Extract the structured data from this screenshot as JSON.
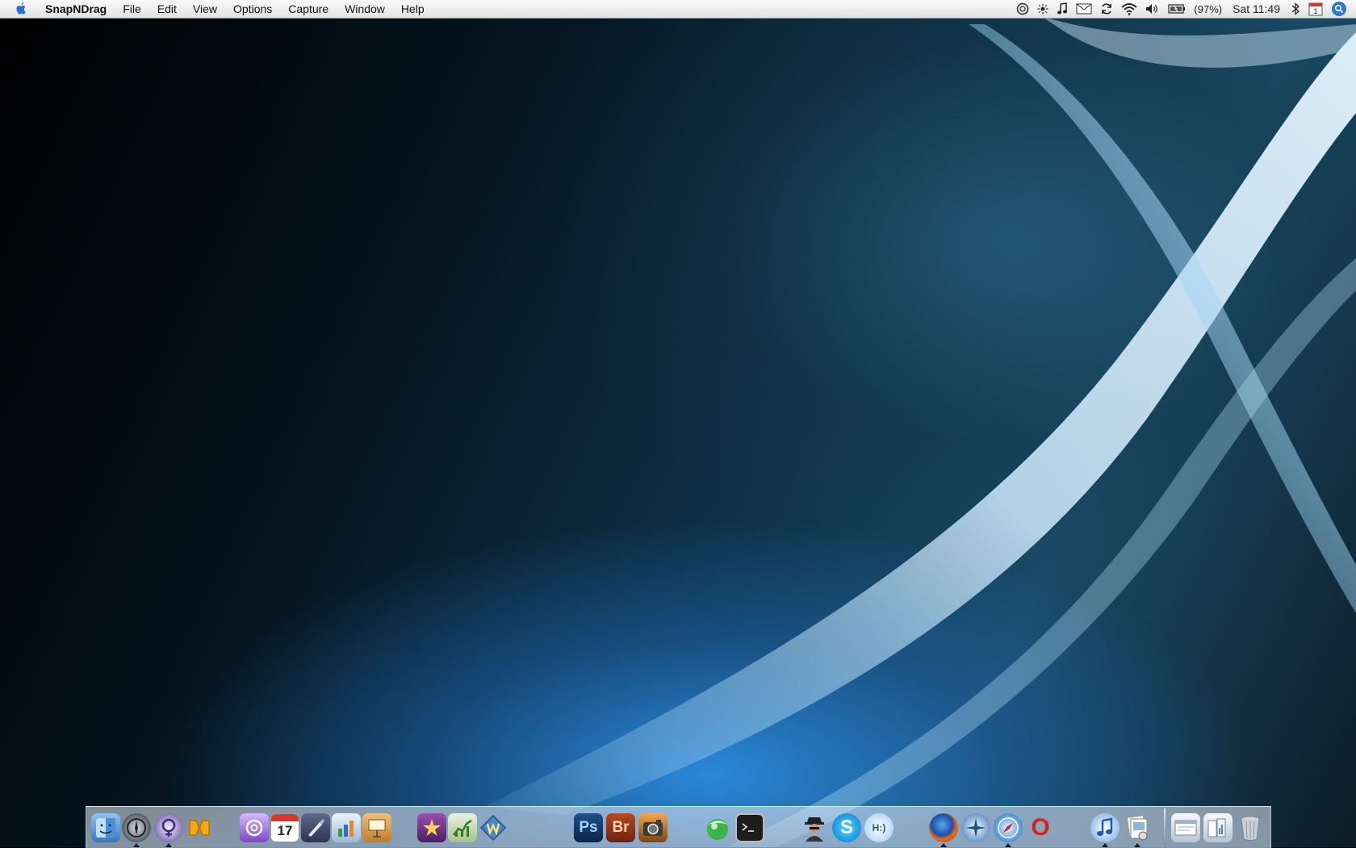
{
  "menubar": {
    "app_name": "SnapNDrag",
    "items": [
      "File",
      "Edit",
      "View",
      "Options",
      "Capture",
      "Window",
      "Help"
    ],
    "battery_text": "(97%)",
    "clock": "Sat 11:49",
    "calendar_day": "1"
  },
  "status_icons": [
    "timer-icon",
    "brightness-icon",
    "music-note-icon",
    "mail-icon",
    "sync-icon",
    "wifi-icon",
    "volume-icon",
    "battery-icon",
    "bluetooth-icon",
    "calendar-icon",
    "spotlight-icon"
  ],
  "dock": {
    "apps": [
      {
        "name": "finder-icon",
        "running": false
      },
      {
        "name": "compass-app-icon",
        "running": true
      },
      {
        "name": "adium-icon",
        "running": true
      },
      {
        "name": "nuvola-icon",
        "running": false
      },
      {
        "name": "mail-stamp-icon",
        "running": false
      },
      {
        "name": "ical-icon",
        "running": false,
        "label": "17"
      },
      {
        "name": "pen-tool-icon",
        "running": false
      },
      {
        "name": "numbers-chart-icon",
        "running": false
      },
      {
        "name": "keynote-icon",
        "running": false
      },
      {
        "name": "aperture-star-icon",
        "running": false
      },
      {
        "name": "stock-chart-icon",
        "running": false
      },
      {
        "name": "wordpress-icon",
        "running": false
      },
      {
        "name": "photoshop-icon",
        "running": false,
        "label": "Ps"
      },
      {
        "name": "bridge-icon",
        "running": false,
        "label": "Br"
      },
      {
        "name": "iphoto-icon",
        "running": false
      },
      {
        "name": "ball-app-icon",
        "running": false
      },
      {
        "name": "terminal-icon",
        "running": false
      },
      {
        "name": "agent-icon",
        "running": false
      },
      {
        "name": "skype-icon",
        "running": false,
        "label": "S"
      },
      {
        "name": "chat-bubble-icon",
        "running": false,
        "label": "H:)"
      },
      {
        "name": "firefox-icon",
        "running": true
      },
      {
        "name": "camino-icon",
        "running": false
      },
      {
        "name": "safari-icon",
        "running": true
      },
      {
        "name": "opera-icon",
        "running": false,
        "label": "O"
      },
      {
        "name": "itunes-icon",
        "running": true
      },
      {
        "name": "preview-icon",
        "running": true
      },
      {
        "name": "downloads-stack-icon",
        "running": false
      },
      {
        "name": "documents-stack-icon",
        "running": false
      },
      {
        "name": "trash-icon",
        "running": false
      }
    ]
  }
}
